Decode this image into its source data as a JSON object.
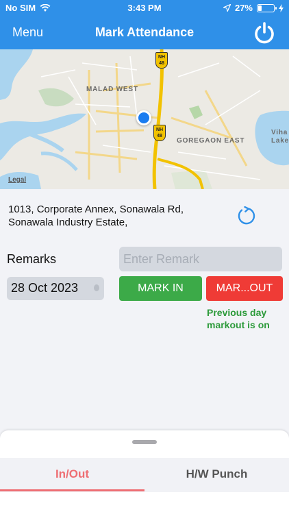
{
  "status_bar": {
    "carrier": "No SIM",
    "time": "3:43 PM",
    "battery": "27%",
    "battery_level": 0.27
  },
  "nav": {
    "menu_label": "Menu",
    "title": "Mark Attendance"
  },
  "map": {
    "area_1": "MALAD WEST",
    "area_2": "GOREGAON EAST",
    "area_3_line1": "Viha",
    "area_3_line2": "Lake",
    "highway_1": "NH\n48",
    "highway_2": "NH\n48",
    "legal": "Legal"
  },
  "location": {
    "address": "1013, Corporate Annex, Sonawala Rd, Sonawala Industry Estate,"
  },
  "form": {
    "remarks_label": "Remarks",
    "remark_placeholder": "Enter Remark",
    "remark_value": "",
    "date": "28 Oct 2023",
    "mark_in_label": "MARK IN",
    "mark_out_label": "MAR...OUT",
    "note": "Previous day markout is on"
  },
  "tabs": [
    {
      "label": "In/Out",
      "active": true
    },
    {
      "label": "H/W Punch",
      "active": false
    }
  ],
  "colors": {
    "primary": "#2f90e8",
    "mark_in": "#3caa48",
    "mark_out": "#ef3b36",
    "active_tab": "#ee6e73",
    "note": "#2c9a3a"
  }
}
